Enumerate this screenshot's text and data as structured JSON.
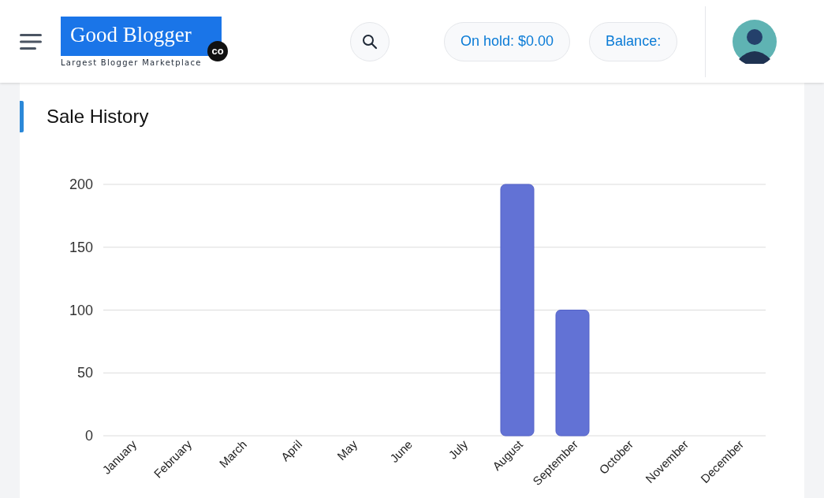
{
  "header": {
    "logo": {
      "title": "Good Blogger",
      "badge": "co",
      "tagline": "Largest Blogger Marketplace"
    },
    "pills": [
      {
        "label": "On hold: $0.00"
      },
      {
        "label": "Balance:"
      }
    ]
  },
  "card": {
    "title": "Sale History",
    "chart_data": {
      "type": "bar",
      "categories": [
        "January",
        "February",
        "March",
        "April",
        "May",
        "June",
        "July",
        "August",
        "September",
        "October",
        "November",
        "December"
      ],
      "grid": true,
      "series": [
        {
          "color": "#6272d5",
          "values": [
            0,
            0,
            0,
            0,
            0,
            0,
            0,
            200,
            100,
            0,
            0,
            0
          ]
        }
      ],
      "ylim": [
        0,
        200
      ],
      "yticks": [
        0,
        50,
        100,
        150,
        200
      ]
    }
  }
}
